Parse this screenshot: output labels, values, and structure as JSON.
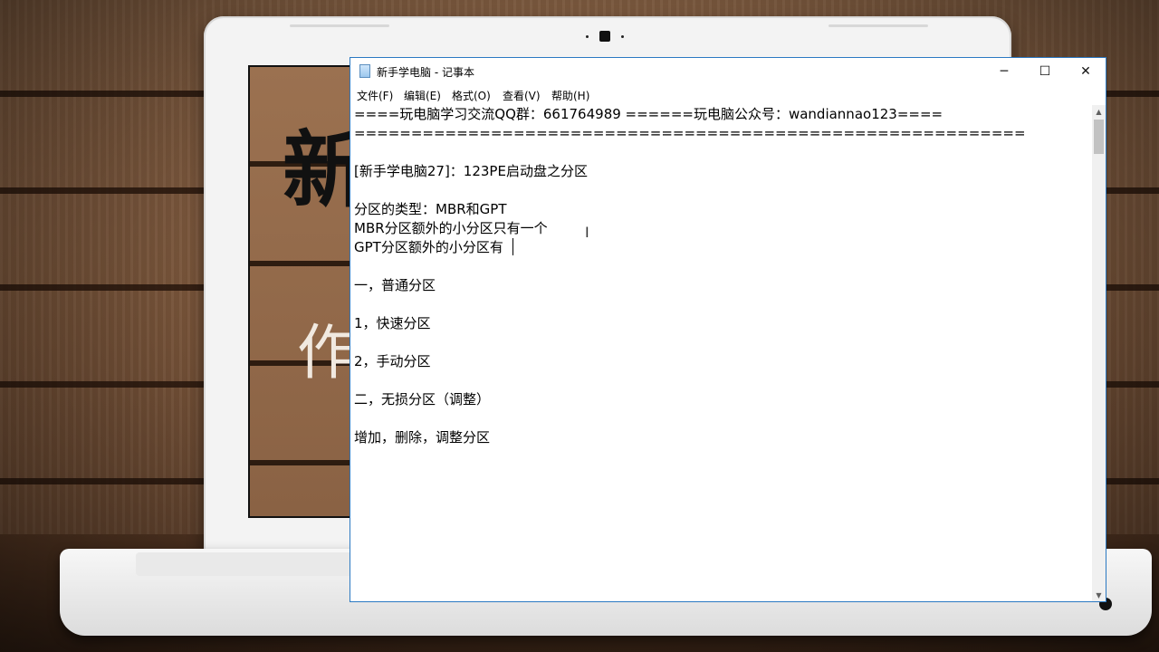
{
  "window": {
    "title": "新手学电脑 - 记事本",
    "controls": {
      "minimize": "─",
      "maximize": "☐",
      "close": "✕"
    }
  },
  "menu": [
    "文件(F)",
    "编辑(E)",
    "格式(O)",
    "查看(V)",
    "帮助(H)"
  ],
  "document_lines": [
    "====玩电脑学习交流QQ群：661764989 ======玩电脑公众号：wandiannao123====",
    "===========================================================",
    "",
    "[新手学电脑27]：123PE启动盘之分区",
    "",
    "分区的类型：MBR和GPT",
    "MBR分区额外的小分区只有一个",
    "GPT分区额外的小分区有",
    "",
    "一，普通分区",
    "",
    "1，快速分区",
    "",
    "2，手动分区",
    "",
    "二，无损分区（调整）",
    "",
    "增加，删除，调整分区"
  ],
  "background": {
    "char_1": "新",
    "char_2": "作"
  },
  "scrollbar": {
    "up_arrow": "▲",
    "down_arrow": "▼"
  },
  "colors": {
    "window_border": "#2b79c2",
    "text": "#000000"
  }
}
